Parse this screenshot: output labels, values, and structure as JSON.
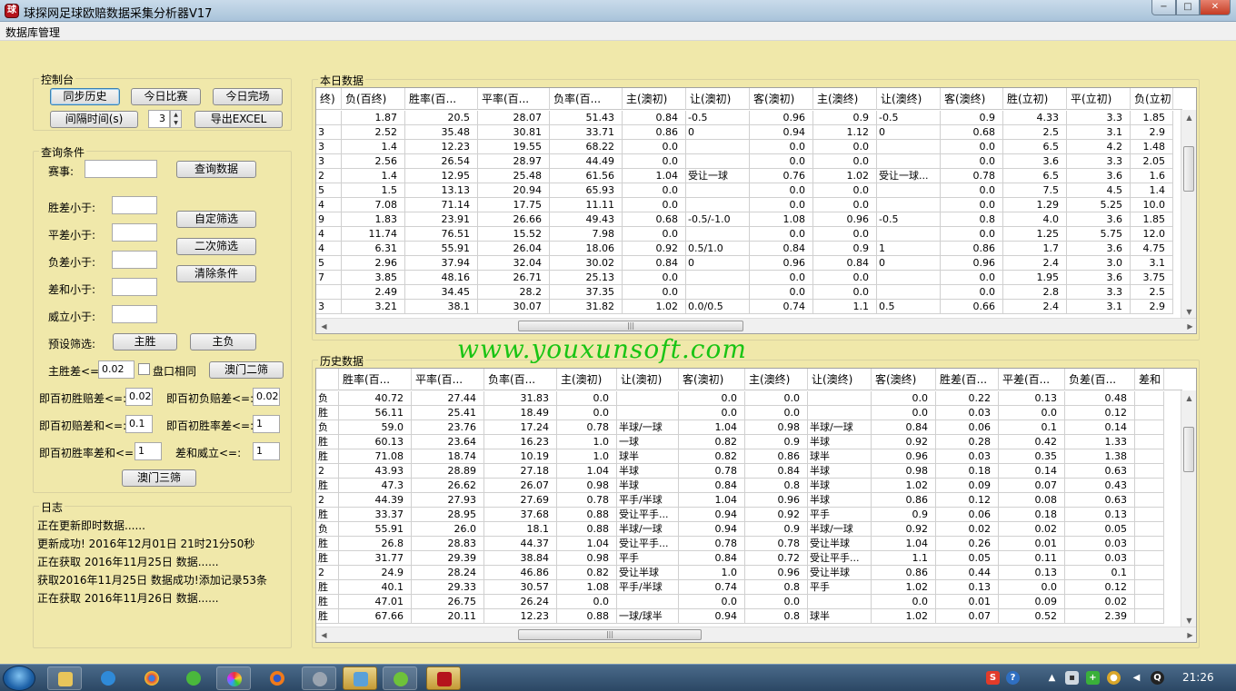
{
  "window": {
    "title": "球探网足球欧赔数据采集分析器V17",
    "app_icon": "app-logo-icon",
    "min": "−",
    "max": "□",
    "close": "✕"
  },
  "menu": {
    "items": [
      "数据库管理"
    ]
  },
  "control": {
    "title": "控制台",
    "sync_history": "同步历史",
    "today_matches": "今日比赛",
    "today_finished": "今日完场",
    "interval_label": "间隔时间(s)",
    "interval_value": "3",
    "export_excel": "导出EXCEL"
  },
  "query": {
    "title": "查询条件",
    "league_label": "赛事:",
    "league_value": "",
    "query_button": "查询数据",
    "win_diff_label": "胜差小于:",
    "draw_diff_label": "平差小于:",
    "loss_diff_label": "负差小于:",
    "diff_sum_label": "差和小于:",
    "weili_label": "威立小于:",
    "custom_filter": "自定筛选",
    "second_filter": "二次筛选",
    "clear_conditions": "清除条件",
    "preset_label": "预设筛选:",
    "home_win": "主胜",
    "home_loss": "主负",
    "home_win_diff_label": "主胜差<=:",
    "home_win_diff_value": "0.02",
    "same_handicap_label": "盘口相同",
    "macau_second": "澳门二筛",
    "init_win_odds_label": "即百初胜赔差<=:",
    "init_win_odds_value": "0.02",
    "init_loss_odds_label": "即百初负赔差<=:",
    "init_loss_odds_value": "0.02",
    "init_odds_sum_label": "即百初赔差和<=:",
    "init_odds_sum_value": "0.1",
    "init_win_rate_label": "即百初胜率差<=:",
    "init_win_rate_value": "1",
    "init_rate_sum_label": "即百初胜率差和<=:",
    "init_rate_sum_value": "1",
    "diff_weili_label": "差和威立<=:",
    "diff_weili_value": "1",
    "macau_third": "澳门三筛"
  },
  "log": {
    "title": "日志",
    "lines": [
      "正在更新即时数据......",
      "更新成功!  2016年12月01日   21时21分50秒",
      "正在获取  2016年11月25日  数据......",
      "获取2016年11月25日  数据成功!添加记录53条",
      "正在获取  2016年11月26日  数据......"
    ]
  },
  "today": {
    "title": "本日数据",
    "columns": [
      "终)",
      "负(百终)",
      "胜率(百...",
      "平率(百...",
      "负率(百...",
      "主(澳初)",
      "让(澳初)",
      "客(澳初)",
      "主(澳终)",
      "让(澳终)",
      "客(澳终)",
      "胜(立初)",
      "平(立初)",
      "负(立初"
    ],
    "rows": [
      [
        "",
        "1.87",
        "20.5",
        "28.07",
        "51.43",
        "0.84",
        "-0.5",
        "0.96",
        "0.9",
        "-0.5",
        "0.9",
        "4.33",
        "3.3",
        "1.85"
      ],
      [
        "3",
        "2.52",
        "35.48",
        "30.81",
        "33.71",
        "0.86",
        "0",
        "0.94",
        "1.12",
        "0",
        "0.68",
        "2.5",
        "3.1",
        "2.9"
      ],
      [
        "3",
        "1.4",
        "12.23",
        "19.55",
        "68.22",
        "0.0",
        "",
        "0.0",
        "0.0",
        "",
        "0.0",
        "6.5",
        "4.2",
        "1.48"
      ],
      [
        "3",
        "2.56",
        "26.54",
        "28.97",
        "44.49",
        "0.0",
        "",
        "0.0",
        "0.0",
        "",
        "0.0",
        "3.6",
        "3.3",
        "2.05"
      ],
      [
        "2",
        "1.4",
        "12.95",
        "25.48",
        "61.56",
        "1.04",
        "受让一球",
        "0.76",
        "1.02",
        "受让一球...",
        "0.78",
        "6.5",
        "3.6",
        "1.6"
      ],
      [
        "5",
        "1.5",
        "13.13",
        "20.94",
        "65.93",
        "0.0",
        "",
        "0.0",
        "0.0",
        "",
        "0.0",
        "7.5",
        "4.5",
        "1.4"
      ],
      [
        "4",
        "7.08",
        "71.14",
        "17.75",
        "11.11",
        "0.0",
        "",
        "0.0",
        "0.0",
        "",
        "0.0",
        "1.29",
        "5.25",
        "10.0"
      ],
      [
        "9",
        "1.83",
        "23.91",
        "26.66",
        "49.43",
        "0.68",
        "-0.5/-1.0",
        "1.08",
        "0.96",
        "-0.5",
        "0.8",
        "4.0",
        "3.6",
        "1.85"
      ],
      [
        "4",
        "11.74",
        "76.51",
        "15.52",
        "7.98",
        "0.0",
        "",
        "0.0",
        "0.0",
        "",
        "0.0",
        "1.25",
        "5.75",
        "12.0"
      ],
      [
        "4",
        "6.31",
        "55.91",
        "26.04",
        "18.06",
        "0.92",
        "0.5/1.0",
        "0.84",
        "0.9",
        "1",
        "0.86",
        "1.7",
        "3.6",
        "4.75"
      ],
      [
        "5",
        "2.96",
        "37.94",
        "32.04",
        "30.02",
        "0.84",
        "0",
        "0.96",
        "0.84",
        "0",
        "0.96",
        "2.4",
        "3.0",
        "3.1"
      ],
      [
        "7",
        "3.85",
        "48.16",
        "26.71",
        "25.13",
        "0.0",
        "",
        "0.0",
        "0.0",
        "",
        "0.0",
        "1.95",
        "3.6",
        "3.75"
      ],
      [
        "",
        "2.49",
        "34.45",
        "28.2",
        "37.35",
        "0.0",
        "",
        "0.0",
        "0.0",
        "",
        "0.0",
        "2.8",
        "3.3",
        "2.5"
      ],
      [
        "3",
        "3.21",
        "38.1",
        "30.07",
        "31.82",
        "1.02",
        "0.0/0.5",
        "0.74",
        "1.1",
        "0.5",
        "0.66",
        "2.4",
        "3.1",
        "2.9"
      ]
    ]
  },
  "history": {
    "title": "历史数据",
    "columns": [
      "",
      "胜率(百...",
      "平率(百...",
      "负率(百...",
      "主(澳初)",
      "让(澳初)",
      "客(澳初)",
      "主(澳终)",
      "让(澳终)",
      "客(澳终)",
      "胜差(百...",
      "平差(百...",
      "负差(百...",
      "差和"
    ],
    "rows": [
      [
        "负",
        "40.72",
        "27.44",
        "31.83",
        "0.0",
        "",
        "0.0",
        "0.0",
        "",
        "0.0",
        "0.22",
        "0.13",
        "0.48",
        ""
      ],
      [
        "胜",
        "56.11",
        "25.41",
        "18.49",
        "0.0",
        "",
        "0.0",
        "0.0",
        "",
        "0.0",
        "0.03",
        "0.0",
        "0.12",
        ""
      ],
      [
        "负",
        "59.0",
        "23.76",
        "17.24",
        "0.78",
        "半球/一球",
        "1.04",
        "0.98",
        "半球/一球",
        "0.84",
        "0.06",
        "0.1",
        "0.14",
        ""
      ],
      [
        "胜",
        "60.13",
        "23.64",
        "16.23",
        "1.0",
        "一球",
        "0.82",
        "0.9",
        "半球",
        "0.92",
        "0.28",
        "0.42",
        "1.33",
        ""
      ],
      [
        "胜",
        "71.08",
        "18.74",
        "10.19",
        "1.0",
        "球半",
        "0.82",
        "0.86",
        "球半",
        "0.96",
        "0.03",
        "0.35",
        "1.38",
        ""
      ],
      [
        "2",
        "43.93",
        "28.89",
        "27.18",
        "1.04",
        "半球",
        "0.78",
        "0.84",
        "半球",
        "0.98",
        "0.18",
        "0.14",
        "0.63",
        ""
      ],
      [
        "胜",
        "47.3",
        "26.62",
        "26.07",
        "0.98",
        "半球",
        "0.84",
        "0.8",
        "半球",
        "1.02",
        "0.09",
        "0.07",
        "0.43",
        ""
      ],
      [
        "2",
        "44.39",
        "27.93",
        "27.69",
        "0.78",
        "平手/半球",
        "1.04",
        "0.96",
        "半球",
        "0.86",
        "0.12",
        "0.08",
        "0.63",
        ""
      ],
      [
        "胜",
        "33.37",
        "28.95",
        "37.68",
        "0.88",
        "受让平手...",
        "0.94",
        "0.92",
        "平手",
        "0.9",
        "0.06",
        "0.18",
        "0.13",
        ""
      ],
      [
        "负",
        "55.91",
        "26.0",
        "18.1",
        "0.88",
        "半球/一球",
        "0.94",
        "0.9",
        "半球/一球",
        "0.92",
        "0.02",
        "0.02",
        "0.05",
        ""
      ],
      [
        "胜",
        "26.8",
        "28.83",
        "44.37",
        "1.04",
        "受让平手...",
        "0.78",
        "0.78",
        "受让半球",
        "1.04",
        "0.26",
        "0.01",
        "0.03",
        ""
      ],
      [
        "胜",
        "31.77",
        "29.39",
        "38.84",
        "0.98",
        "平手",
        "0.84",
        "0.72",
        "受让平手...",
        "1.1",
        "0.05",
        "0.11",
        "0.03",
        ""
      ],
      [
        "2",
        "24.9",
        "28.24",
        "46.86",
        "0.82",
        "受让半球",
        "1.0",
        "0.96",
        "受让半球",
        "0.86",
        "0.44",
        "0.13",
        "0.1",
        ""
      ],
      [
        "胜",
        "40.1",
        "29.33",
        "30.57",
        "1.08",
        "平手/半球",
        "0.74",
        "0.8",
        "平手",
        "1.02",
        "0.13",
        "0.0",
        "0.12",
        ""
      ],
      [
        "胜",
        "47.01",
        "26.75",
        "26.24",
        "0.0",
        "",
        "0.0",
        "0.0",
        "",
        "0.0",
        "0.01",
        "0.09",
        "0.02",
        ""
      ],
      [
        "胜",
        "67.66",
        "20.11",
        "12.23",
        "0.88",
        "一球/球半",
        "0.94",
        "0.8",
        "球半",
        "1.02",
        "0.07",
        "0.52",
        "2.39",
        ""
      ]
    ]
  },
  "watermark": "www.youxunsoft.com",
  "taskbar": {
    "clock": "21:26",
    "apps": [
      "explorer-icon",
      "ie-icon",
      "chrome-icon",
      "browser-360-icon",
      "pinwheel-icon",
      "firefox-icon",
      "disk-icon",
      "screenshot-icon",
      "green-app-icon",
      "app-logo-icon"
    ]
  }
}
